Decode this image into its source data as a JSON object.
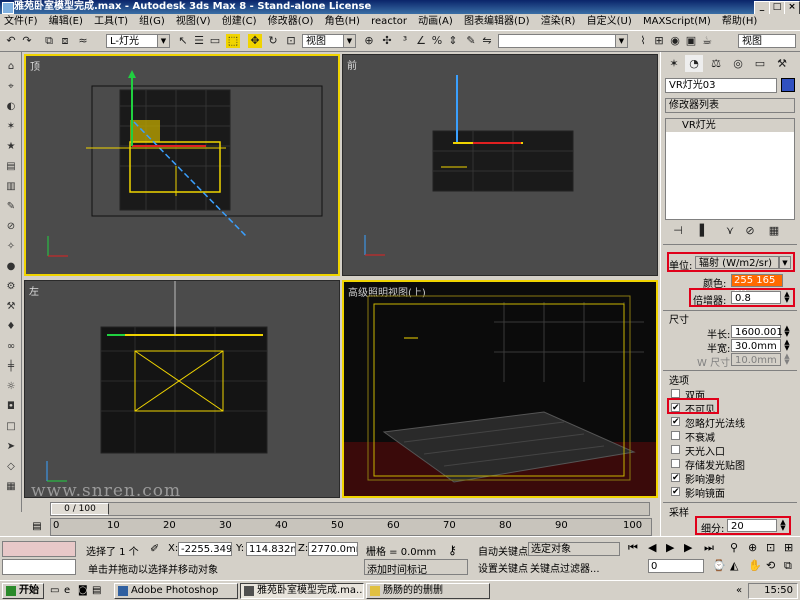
{
  "window": {
    "title": "雅苑卧室模型完成.max - Autodesk 3ds Max 8 - Stand-alone License",
    "minimize": "_",
    "maximize": "□",
    "close": "×"
  },
  "menu": [
    "文件(F)",
    "编辑(E)",
    "工具(T)",
    "组(G)",
    "视图(V)",
    "创建(C)",
    "修改器(O)",
    "角色(H)",
    "reactor",
    "动画(A)",
    "图表编辑器(D)",
    "渲染(R)",
    "自定义(U)",
    "MAXScript(M)",
    "帮助(H)"
  ],
  "toolbar": {
    "selection_filter": "L-灯光",
    "ref_coord": "视图",
    "named_selection": "",
    "render_view": "视图"
  },
  "viewports": {
    "top": "顶",
    "front": "前",
    "left": "左",
    "persp": "高级照明视图(上)"
  },
  "watermark": "www.snren.com",
  "panel": {
    "object_name": "VR灯光03",
    "modifier_list": "修改器列表",
    "stack_item": "VR灯光",
    "units_label": "单位:",
    "units_value": "辐射 (W/m2/sr)",
    "color_label": "颜色:",
    "color_value": "255 165 69",
    "color_swatch": "#ff6a00",
    "multiplier_label": "倍增器:",
    "multiplier_value": "0.8",
    "size_group": "尺寸",
    "half_length_label": "半长:",
    "half_length_value": "1600.001",
    "half_width_label": "半宽:",
    "half_width_value": "30.0mm",
    "w_size_label": "W 尺寸",
    "w_size_value": "10.0mm",
    "options_group": "选项",
    "options": [
      {
        "label": "双面",
        "checked": false
      },
      {
        "label": "不可见",
        "checked": true
      },
      {
        "label": "忽略灯光法线",
        "checked": true
      },
      {
        "label": "不衰减",
        "checked": false
      },
      {
        "label": "天光入口",
        "checked": false
      },
      {
        "label": "存储发光贴图",
        "checked": false
      },
      {
        "label": "影响漫射",
        "checked": true
      },
      {
        "label": "影响镜面",
        "checked": true
      }
    ],
    "sampling_group": "采样",
    "subdivs_label": "细分:",
    "subdivs_value": "20"
  },
  "timeline": {
    "frame_counter": "0 / 100",
    "ticks": [
      "0",
      "10",
      "20",
      "30",
      "40",
      "50",
      "60",
      "70",
      "80",
      "90",
      "100"
    ]
  },
  "status": {
    "selected": "选择了 1 个",
    "x_label": "X:",
    "x_value": "-2255.349",
    "y_label": "Y:",
    "y_value": "114.832mm",
    "z_label": "Z:",
    "z_value": "2770.0mm",
    "grid": "栅格 = 0.0mm",
    "auto_key": "自动关键点",
    "selected_obj": "选定对象",
    "set_key": "设置关键点",
    "key_filters": "关键点过滤器...",
    "prompt": "单击并拖动以选择并移动对象",
    "add_time_tag": "添加时间标记",
    "frame": "0"
  },
  "taskbar": {
    "start": "开始",
    "items": [
      {
        "label": "Adobe Photoshop",
        "active": false
      },
      {
        "label": "雅苑卧室模型完成.ma...",
        "active": true
      },
      {
        "label": "肠肠的的删删",
        "active": false
      }
    ],
    "clock": "15:50"
  }
}
